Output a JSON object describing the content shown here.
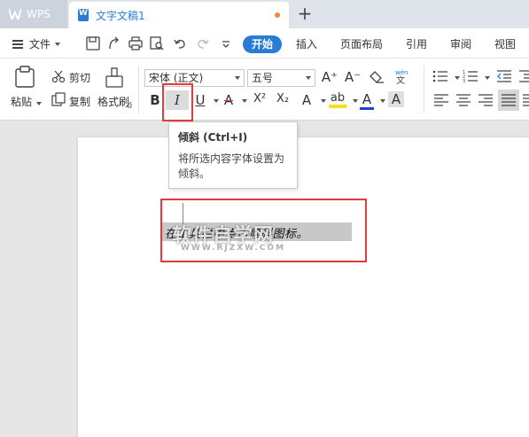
{
  "tabbar": {
    "app_tab": "WPS",
    "doc_tab": "文字文稿1",
    "add_tab": "+"
  },
  "menubar": {
    "file": "文件",
    "ribbon_tabs": [
      "开始",
      "插入",
      "页面布局",
      "引用",
      "审阅",
      "视图"
    ],
    "active_tab": "开始"
  },
  "toolbar": {
    "paste": "粘贴",
    "cut": "剪切",
    "copy": "复制",
    "format_painter": "格式刷",
    "font_name": "宋体 (正文)",
    "font_size": "五号",
    "grow": "A⁺",
    "shrink": "A⁻",
    "bold": "B",
    "italic": "I",
    "underline": "U",
    "strike": "A",
    "superscript": "X²",
    "subscript": "X₂",
    "font_effect": "A",
    "highlight": "ab",
    "font_color": "A",
    "char_shade": "A"
  },
  "tooltip": {
    "title": "倾斜 (Ctrl+I)",
    "body": "将所选内容字体设置为倾斜。"
  },
  "document": {
    "selected_text": "在工具栏中点击倾斜图标。",
    "watermark": "软件自学网",
    "watermark_url": "WWW.RJZXW.COM"
  },
  "colors": {
    "accent": "#2a7bd6",
    "highlight_box": "#e23b3b",
    "font_color_underline": "#1f3fd6",
    "highlight_yellow": "#f5e020"
  }
}
